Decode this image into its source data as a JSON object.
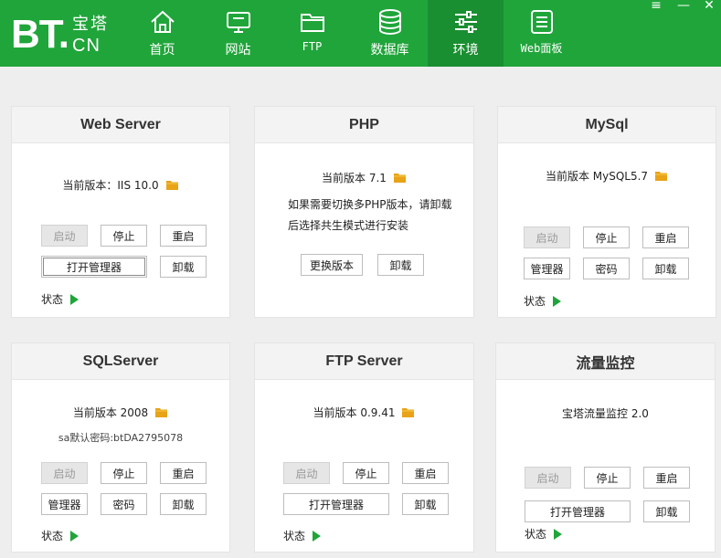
{
  "app": {
    "logo_main": "BT.",
    "logo_cn_top": "宝塔",
    "logo_cn_bot": "CN"
  },
  "nav": [
    {
      "label": "首页",
      "icon": "home-icon"
    },
    {
      "label": "网站",
      "icon": "monitor-icon"
    },
    {
      "label": "FTP",
      "icon": "folder-icon"
    },
    {
      "label": "数据库",
      "icon": "database-icon"
    },
    {
      "label": "环境",
      "icon": "sliders-icon",
      "active": true
    },
    {
      "label": "Web面板",
      "icon": "list-icon"
    }
  ],
  "window": {
    "menu": "≡",
    "minimize": "—",
    "close": "✕"
  },
  "colors": {
    "brand": "#20a53a",
    "brand_active": "#1a8f31",
    "status": "#20a53a",
    "folder": "#e8a317"
  },
  "cards": {
    "web": {
      "title": "Web Server",
      "version": "当前版本：IIS 10.0",
      "buttons": {
        "start": "启动",
        "stop": "停止",
        "restart": "重启",
        "open_manager": "打开管理器",
        "uninstall": "卸载"
      },
      "start_disabled": true,
      "status": "状态"
    },
    "php": {
      "title": "PHP",
      "version": "当前版本 7.1",
      "note1": "如果需要切换多PHP版本，请卸载",
      "note2": "后选择共生模式进行安装",
      "buttons": {
        "change_version": "更换版本",
        "uninstall": "卸载"
      }
    },
    "mysql": {
      "title": "MySql",
      "version": "当前版本 MySQL5.7",
      "buttons": {
        "start": "启动",
        "stop": "停止",
        "restart": "重启",
        "manager": "管理器",
        "password": "密码",
        "uninstall": "卸载"
      },
      "start_disabled": true,
      "status": "状态"
    },
    "sqlserver": {
      "title": "SQLServer",
      "version": "当前版本 2008",
      "password_line": "sa默认密码:btDA2795078",
      "buttons": {
        "start": "启动",
        "stop": "停止",
        "restart": "重启",
        "manager": "管理器",
        "password": "密码",
        "uninstall": "卸载"
      },
      "start_disabled": true,
      "status": "状态"
    },
    "ftp": {
      "title": "FTP Server",
      "version": "当前版本 0.9.41",
      "buttons": {
        "start": "启动",
        "stop": "停止",
        "restart": "重启",
        "open_manager": "打开管理器",
        "uninstall": "卸载"
      },
      "start_disabled": true,
      "status": "状态"
    },
    "traffic": {
      "title": "流量监控",
      "version": "宝塔流量监控 2.0",
      "buttons": {
        "start": "启动",
        "stop": "停止",
        "restart": "重启",
        "open_manager": "打开管理器",
        "uninstall": "卸载"
      },
      "start_disabled": true,
      "status": "状态"
    }
  }
}
